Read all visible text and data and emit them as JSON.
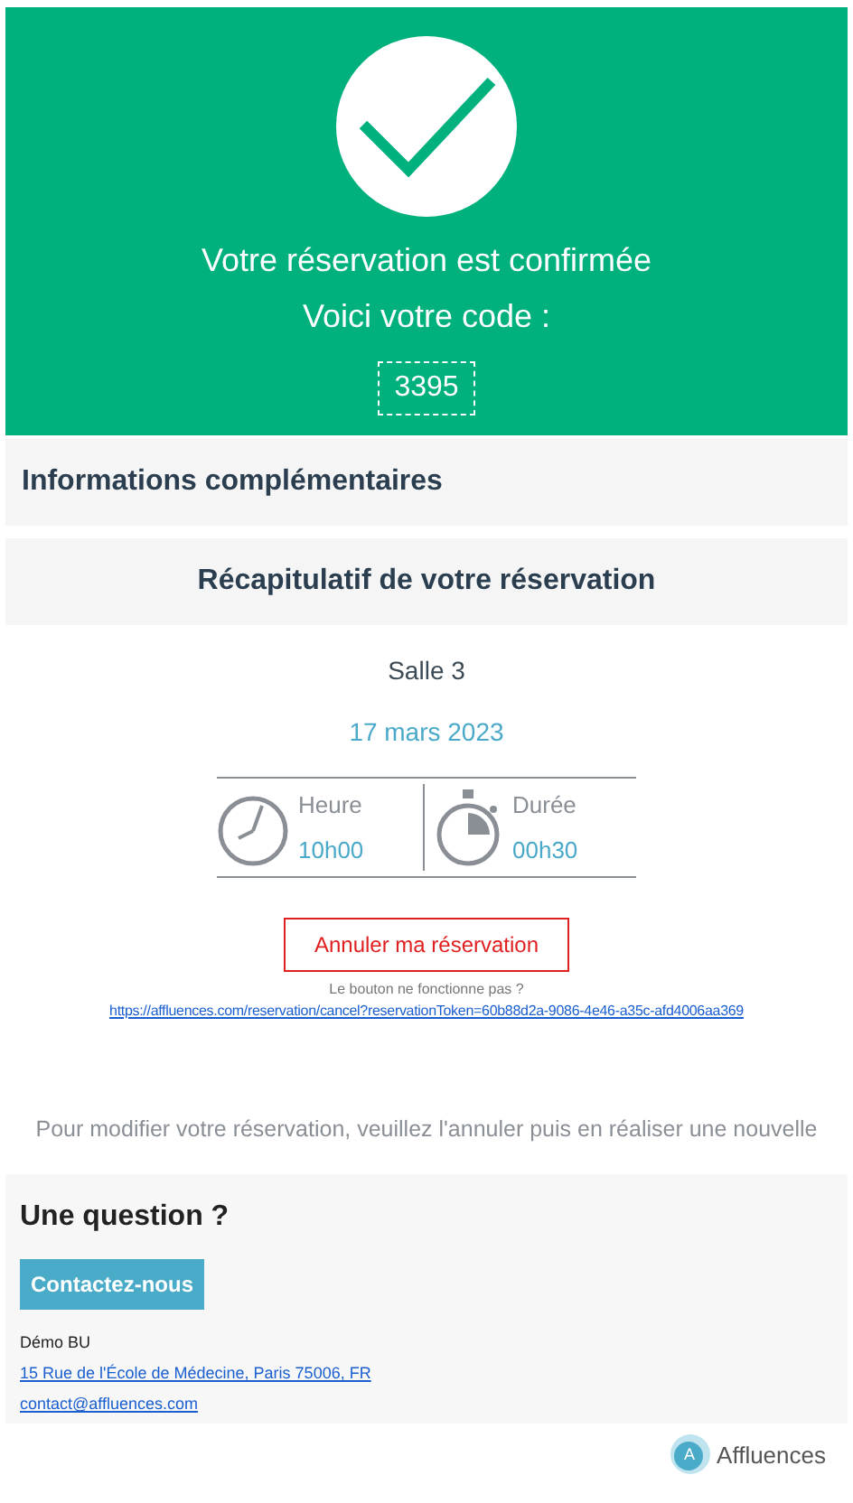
{
  "header": {
    "title": "Votre réservation est confirmée",
    "code_label": "Voici votre code :",
    "code": "3395"
  },
  "info_bar": {
    "title": "Informations complémentaires"
  },
  "summary": {
    "title": "Récapitulatif de votre réservation",
    "room": "Salle 3",
    "date": "17 mars 2023",
    "details": [
      {
        "kind": "clock",
        "label": "Heure",
        "value": "10h00"
      },
      {
        "kind": "stopwatch",
        "label": "Durée",
        "value": "00h30"
      }
    ]
  },
  "cancel": {
    "button": "Annuler ma réservation",
    "help": "Le bouton ne fonctionne pas ?",
    "link": "https://affluences.com/reservation/cancel?reservationToken=60b88d2a-9086-4e46-a35c-afd4006aa369"
  },
  "notice": "Pour modifier votre réservation, veuillez l'annuler puis en réaliser une nouvelle",
  "contact": {
    "title": "Une question ?",
    "button": "Contactez-nous",
    "name": "Démo BU",
    "address": "15 Rue de l'École de Médecine, Paris 75006, FR",
    "email": "contact@affluences.com"
  },
  "footer": {
    "logo_letter": "A",
    "brand": "Affluences"
  }
}
